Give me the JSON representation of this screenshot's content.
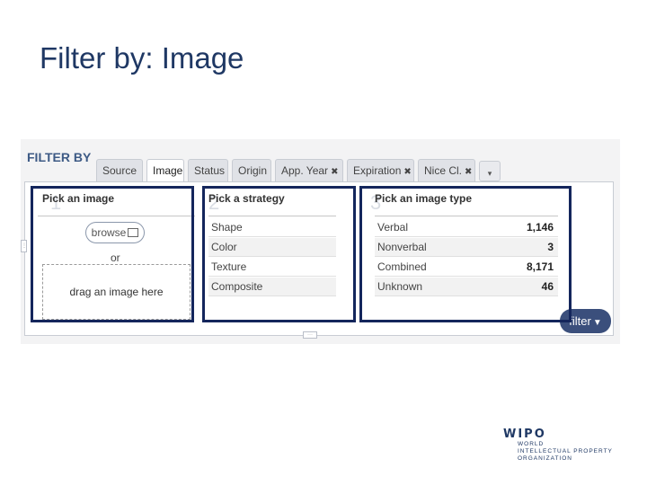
{
  "slide": {
    "title": "Filter by: Image"
  },
  "filter": {
    "header": "FILTER BY",
    "tabs": [
      {
        "label": "Source",
        "closable": false,
        "active": false
      },
      {
        "label": "Image",
        "closable": false,
        "active": true
      },
      {
        "label": "Status",
        "closable": false,
        "active": false
      },
      {
        "label": "Origin",
        "closable": false,
        "active": false
      },
      {
        "label": "App. Year",
        "closable": true,
        "active": false
      },
      {
        "label": "Expiration",
        "closable": true,
        "active": false
      },
      {
        "label": "Nice Cl.",
        "closable": true,
        "active": false
      }
    ],
    "more_icon": "▾",
    "close_glyph": "✖",
    "highlight_color": "#14265c"
  },
  "pick_image": {
    "title": "Pick an image",
    "browse_label": "browse",
    "or_label": "or",
    "dropzone_label": "drag an image here"
  },
  "strategy": {
    "title": "Pick a strategy",
    "items": [
      "Shape",
      "Color",
      "Texture",
      "Composite"
    ]
  },
  "image_type": {
    "title": "Pick an image type",
    "items": [
      {
        "label": "Verbal",
        "count": "1,146"
      },
      {
        "label": "Nonverbal",
        "count": "3"
      },
      {
        "label": "Combined",
        "count": "8,171"
      },
      {
        "label": "Unknown",
        "count": "46"
      }
    ]
  },
  "filter_button": {
    "label": "filter",
    "icon": "funnel-icon"
  },
  "ghost_numbers": [
    "1",
    "2",
    "3"
  ],
  "logo": {
    "name": "WIPO",
    "lines": [
      "WORLD",
      "INTELLECTUAL PROPERTY",
      "ORGANIZATION"
    ]
  }
}
